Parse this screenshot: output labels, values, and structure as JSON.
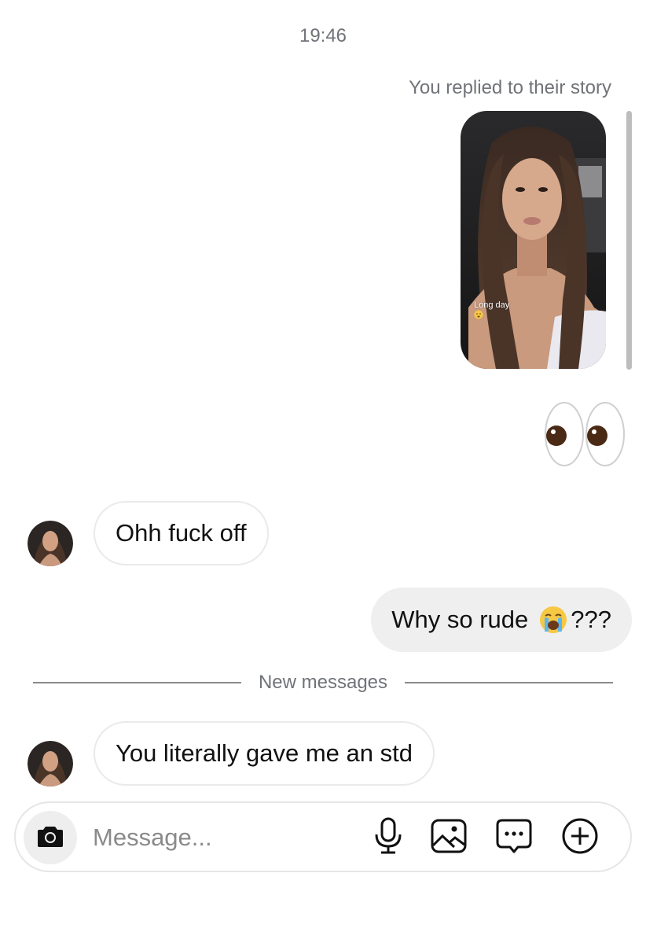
{
  "thread": {
    "timestamp": "19:46",
    "story_reply": {
      "caption": "You replied to their story",
      "story_text": "Long day"
    },
    "reaction_emoji": "eyes-emoji",
    "messages": [
      {
        "direction": "incoming",
        "text": "Ohh fuck off"
      },
      {
        "direction": "outgoing",
        "text": "Why so rude",
        "emoji": "loudly-crying-face",
        "suffix": "???"
      },
      {
        "direction": "incoming",
        "text": "You literally gave me an std"
      }
    ],
    "new_messages_divider": "New messages"
  },
  "composer": {
    "placeholder": "Message...",
    "icons": [
      "camera-icon",
      "microphone-icon",
      "gallery-icon",
      "sticker-icon",
      "plus-icon"
    ]
  },
  "colors": {
    "secondary_text": "#707378",
    "outgoing_bubble": "#efefef",
    "incoming_border": "#eaeaea"
  }
}
